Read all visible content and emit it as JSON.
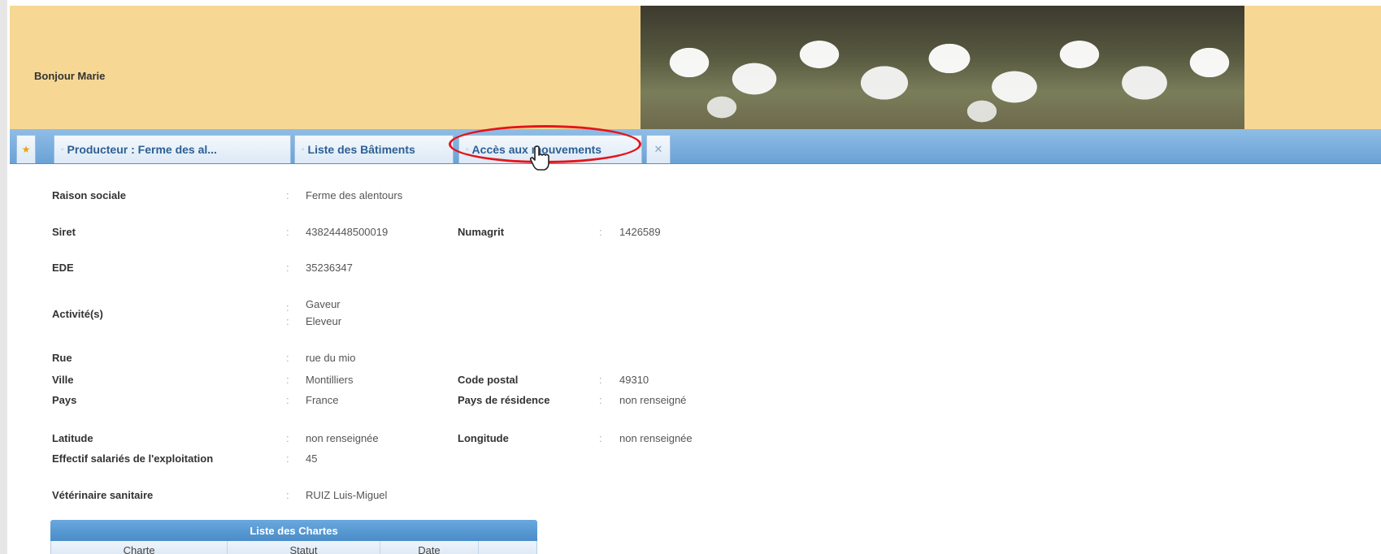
{
  "header": {
    "greeting": "Bonjour Marie"
  },
  "tabs": [
    {
      "label": "Producteur : Ferme des al...",
      "active": false
    },
    {
      "label": "Liste des Bâtiments",
      "active": false
    },
    {
      "label": "Accès aux mouvements",
      "active": true
    }
  ],
  "tab_star_icon": "star-icon",
  "tab_close_icon": "close-icon",
  "details": {
    "raison_sociale": {
      "label": "Raison sociale",
      "value": "Ferme des alentours"
    },
    "siret": {
      "label": "Siret",
      "value": "43824448500019"
    },
    "numagrit": {
      "label": "Numagrit",
      "value": "1426589"
    },
    "ede": {
      "label": "EDE",
      "value": "35236347"
    },
    "activites": {
      "label": "Activité(s)",
      "value1": "Gaveur",
      "value2": "Eleveur"
    },
    "rue": {
      "label": "Rue",
      "value": "rue du mio"
    },
    "ville": {
      "label": "Ville",
      "value": "Montilliers"
    },
    "code_postal": {
      "label": "Code postal",
      "value": "49310"
    },
    "pays": {
      "label": "Pays",
      "value": "France"
    },
    "pays_residence": {
      "label": "Pays de résidence",
      "value": "non renseigné"
    },
    "latitude": {
      "label": "Latitude",
      "value": "non renseignée"
    },
    "longitude": {
      "label": "Longitude",
      "value": "non renseignée"
    },
    "effectif": {
      "label": "Effectif salariés de l'exploitation",
      "value": "45"
    },
    "veterinaire": {
      "label": "Vétérinaire sanitaire",
      "value": "RUIZ Luis-Miguel"
    }
  },
  "separator": ":",
  "chartes": {
    "title": "Liste des Chartes",
    "columns": [
      "Charte",
      "Statut",
      "Date"
    ]
  },
  "colors": {
    "header_bg": "#f6d894",
    "tabbar": "#6aa2d6",
    "highlight": "#e4141b"
  }
}
